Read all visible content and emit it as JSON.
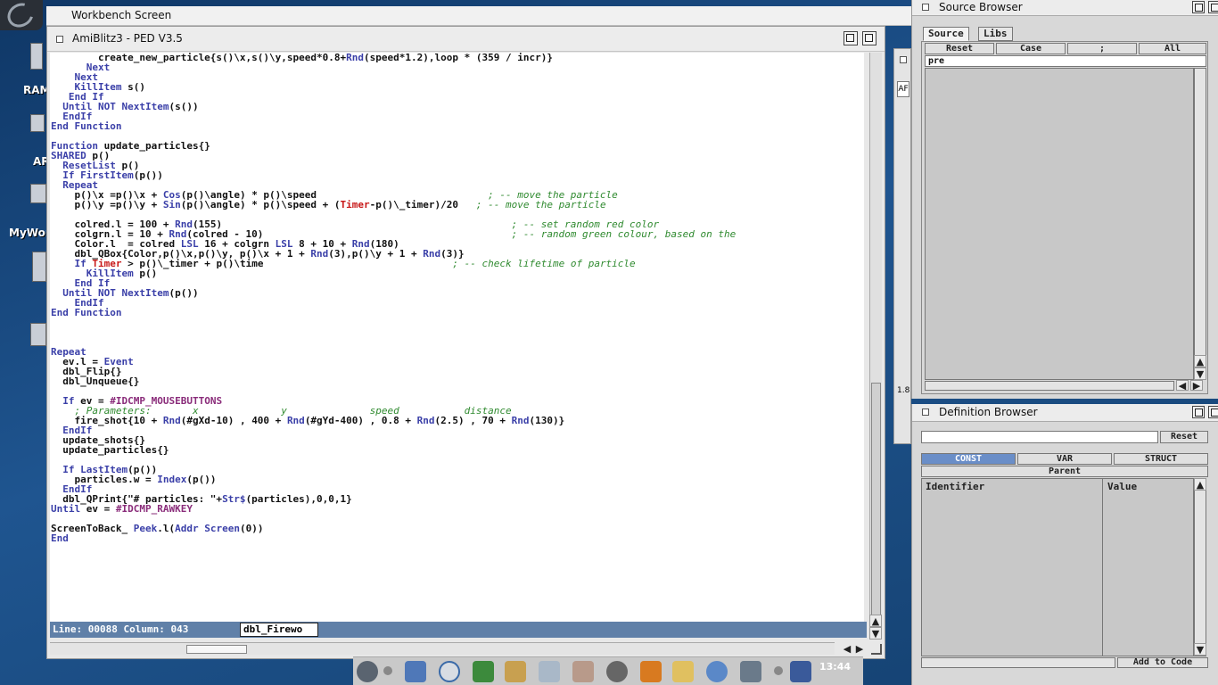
{
  "desktop": {
    "icons": [
      "RAM",
      "AR",
      "MyWor"
    ]
  },
  "workbench": {
    "title": "Workbench Screen"
  },
  "ped": {
    "title": "AmiBlitz3 - PED V3.5",
    "status_line": "Line: 00088 Column: 043",
    "status_tab": "dbl_Firewo"
  },
  "code_lines": [
    [
      [
        "        create_new_particle{s()\\x,s()\\y,speed*0.8+",
        ""
      ],
      [
        "Rnd",
        "k"
      ],
      [
        "(speed*1.2),loop * (359 / incr)}",
        ""
      ]
    ],
    [
      [
        "      ",
        ""
      ],
      [
        "Next",
        "k"
      ]
    ],
    [
      [
        "    ",
        ""
      ],
      [
        "Next",
        "k"
      ]
    ],
    [
      [
        "    ",
        ""
      ],
      [
        "KillItem",
        "k"
      ],
      [
        " s()",
        ""
      ]
    ],
    [
      [
        "   ",
        ""
      ],
      [
        "End If",
        "k"
      ]
    ],
    [
      [
        "  ",
        ""
      ],
      [
        "Until",
        "k"
      ],
      [
        " ",
        ""
      ],
      [
        "NOT",
        "k"
      ],
      [
        " ",
        ""
      ],
      [
        "NextItem",
        "k"
      ],
      [
        "(s())",
        ""
      ]
    ],
    [
      [
        "  ",
        ""
      ],
      [
        "EndIf",
        "k"
      ]
    ],
    [
      [
        "End Function",
        "k"
      ]
    ],
    [
      [
        "",
        ""
      ]
    ],
    [
      [
        "Function",
        "k"
      ],
      [
        " update_particles{}",
        ""
      ]
    ],
    [
      [
        "SHARED",
        "k"
      ],
      [
        " p()",
        ""
      ]
    ],
    [
      [
        "  ",
        ""
      ],
      [
        "ResetList",
        "k"
      ],
      [
        " p()",
        ""
      ]
    ],
    [
      [
        "  ",
        ""
      ],
      [
        "If",
        "k"
      ],
      [
        " ",
        ""
      ],
      [
        "FirstItem",
        "k"
      ],
      [
        "(p())",
        ""
      ]
    ],
    [
      [
        "  ",
        ""
      ],
      [
        "Repeat",
        "k"
      ]
    ],
    [
      [
        "    p()\\x =p()\\x + ",
        ""
      ],
      [
        "Cos",
        "k"
      ],
      [
        "(p()\\angle) * p()\\speed                             ",
        ""
      ],
      [
        "; -- move the particle",
        "c"
      ]
    ],
    [
      [
        "    p()\\y =p()\\y + ",
        ""
      ],
      [
        "Sin",
        "k"
      ],
      [
        "(p()\\angle) * p()\\speed + (",
        ""
      ],
      [
        "Timer",
        "r"
      ],
      [
        "-p()\\_timer)/20   ",
        ""
      ],
      [
        "; -- move the particle",
        "c"
      ]
    ],
    [
      [
        "",
        ""
      ]
    ],
    [
      [
        "    colred.l = 100 + ",
        ""
      ],
      [
        "Rnd",
        "k"
      ],
      [
        "(155)                                                 ",
        ""
      ],
      [
        "; -- set random red color",
        "c"
      ]
    ],
    [
      [
        "    colgrn.l = 10 + ",
        ""
      ],
      [
        "Rnd",
        "k"
      ],
      [
        "(colred - 10)                                          ",
        ""
      ],
      [
        "; -- random green colour, based on the",
        "c"
      ]
    ],
    [
      [
        "    Color.l  = colred ",
        ""
      ],
      [
        "LSL",
        "k"
      ],
      [
        " 16 + colgrn ",
        ""
      ],
      [
        "LSL",
        "k"
      ],
      [
        " 8 + 10 + ",
        ""
      ],
      [
        "Rnd",
        "k"
      ],
      [
        "(180)",
        ""
      ]
    ],
    [
      [
        "    dbl_QBox{Color,p()\\x,p()\\y, p()\\x + 1 + ",
        ""
      ],
      [
        "Rnd",
        "k"
      ],
      [
        "(3),p()\\y + 1 + ",
        ""
      ],
      [
        "Rnd",
        "k"
      ],
      [
        "(3)}",
        ""
      ]
    ],
    [
      [
        "    ",
        ""
      ],
      [
        "If",
        "k"
      ],
      [
        " ",
        ""
      ],
      [
        "Timer",
        "r"
      ],
      [
        " > p()\\_timer + p()\\time                                ",
        ""
      ],
      [
        "; -- check lifetime of particle",
        "c"
      ]
    ],
    [
      [
        "      ",
        ""
      ],
      [
        "KillItem",
        "k"
      ],
      [
        " p()",
        ""
      ]
    ],
    [
      [
        "    ",
        ""
      ],
      [
        "End If",
        "k"
      ]
    ],
    [
      [
        "  ",
        ""
      ],
      [
        "Until",
        "k"
      ],
      [
        " ",
        ""
      ],
      [
        "NOT",
        "k"
      ],
      [
        " ",
        ""
      ],
      [
        "NextItem",
        "k"
      ],
      [
        "(p())",
        ""
      ]
    ],
    [
      [
        "    ",
        ""
      ],
      [
        "EndIf",
        "k"
      ]
    ],
    [
      [
        "End Function",
        "k"
      ]
    ],
    [
      [
        "",
        ""
      ]
    ],
    [
      [
        "",
        ""
      ]
    ],
    [
      [
        "",
        ""
      ]
    ],
    [
      [
        "Repeat",
        "k"
      ]
    ],
    [
      [
        "  ev.l = ",
        ""
      ],
      [
        "Event",
        "k"
      ]
    ],
    [
      [
        "  dbl_Flip{}",
        ""
      ]
    ],
    [
      [
        "  dbl_Unqueue{}",
        ""
      ]
    ],
    [
      [
        "",
        ""
      ]
    ],
    [
      [
        "  ",
        ""
      ],
      [
        "If",
        "k"
      ],
      [
        " ev = ",
        ""
      ],
      [
        "#IDCMP_MOUSEBUTTONS",
        "p"
      ]
    ],
    [
      [
        "    ",
        ""
      ],
      [
        "; Parameters:       x              y              speed           distance",
        "c"
      ]
    ],
    [
      [
        "    fire_shot{10 + ",
        ""
      ],
      [
        "Rnd",
        "k"
      ],
      [
        "(#gXd-10) , 400 + ",
        ""
      ],
      [
        "Rnd",
        "k"
      ],
      [
        "(#gYd-400) , 0.8 + ",
        ""
      ],
      [
        "Rnd",
        "k"
      ],
      [
        "(2.5) , 70 + ",
        ""
      ],
      [
        "Rnd",
        "k"
      ],
      [
        "(130)}",
        ""
      ]
    ],
    [
      [
        "  ",
        ""
      ],
      [
        "EndIf",
        "k"
      ]
    ],
    [
      [
        "  update_shots{}",
        ""
      ]
    ],
    [
      [
        "  update_particles{}",
        ""
      ]
    ],
    [
      [
        "",
        ""
      ]
    ],
    [
      [
        "  ",
        ""
      ],
      [
        "If",
        "k"
      ],
      [
        " ",
        ""
      ],
      [
        "LastItem",
        "k"
      ],
      [
        "(p())",
        ""
      ]
    ],
    [
      [
        "    particles.w = ",
        ""
      ],
      [
        "Index",
        "k"
      ],
      [
        "(p())",
        ""
      ]
    ],
    [
      [
        "  ",
        ""
      ],
      [
        "EndIf",
        "k"
      ]
    ],
    [
      [
        "  dbl_QPrint{\"# particles: \"+",
        ""
      ],
      [
        "Str$",
        "k"
      ],
      [
        "(particles),0,0,1}",
        ""
      ]
    ],
    [
      [
        "Until",
        "k"
      ],
      [
        " ev = ",
        ""
      ],
      [
        "#IDCMP_RAWKEY",
        "p"
      ]
    ],
    [
      [
        "",
        ""
      ]
    ],
    [
      [
        "ScreenToBack_",
        ""
      ],
      [
        " ",
        ""
      ],
      [
        "Peek",
        "k"
      ],
      [
        ".l(",
        ""
      ],
      [
        "Addr",
        "k"
      ],
      [
        " ",
        ""
      ],
      [
        "Screen",
        "k"
      ],
      [
        "(0))",
        ""
      ]
    ],
    [
      [
        "End",
        "k"
      ]
    ]
  ],
  "source_browser": {
    "title": "Source Browser",
    "tabs": [
      "Source",
      "Libs"
    ],
    "buttons": [
      "Reset",
      "Case",
      ";",
      "All"
    ],
    "filter_value": "pre"
  },
  "definition_browser": {
    "title": "Definition Browser",
    "reset_label": "Reset",
    "segments": [
      "CONST",
      "VAR",
      "STRUCT"
    ],
    "parent_label": "Parent",
    "col_identifier": "Identifier",
    "col_value": "Value",
    "add_label": "Add to Code"
  },
  "bg_window": {
    "label1": "AF",
    "label2": "1.8"
  },
  "dock": {
    "clock": "13:44"
  }
}
